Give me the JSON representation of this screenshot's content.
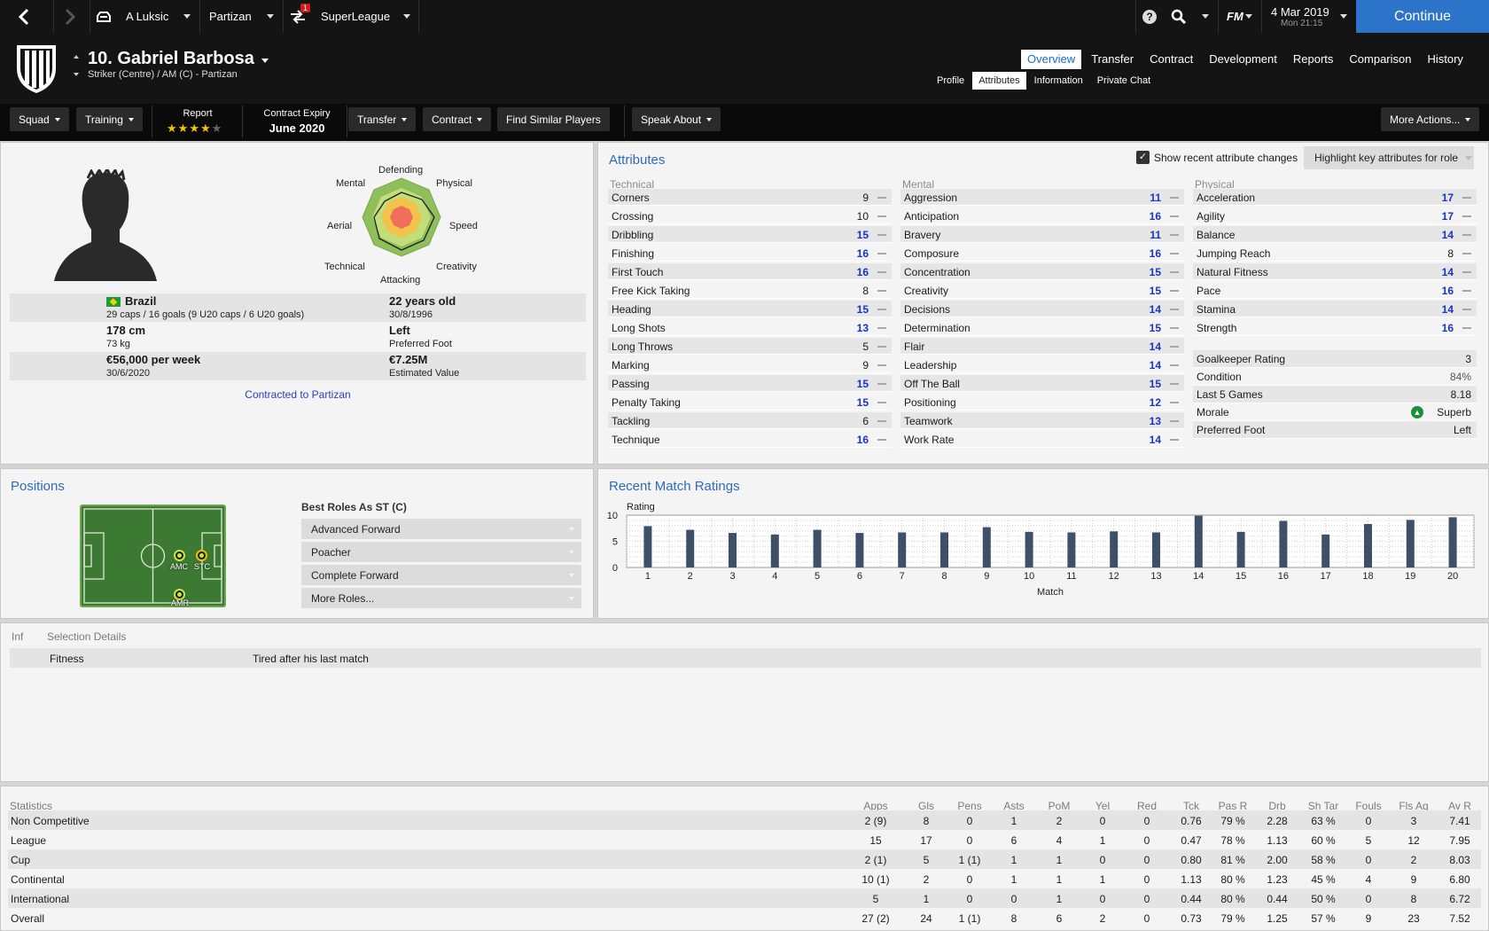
{
  "topbar": {
    "manager": "A Luksic",
    "club": "Partizan",
    "league": "SuperLeague",
    "notification_count": "1",
    "fm_logo": "FM",
    "date": "4 Mar 2019",
    "time": "Mon 21:15",
    "continue_label": "Continue",
    "icons": [
      "back-arrow",
      "forward-arrow",
      "home-icon",
      "transfer-notification-icon",
      "help-icon",
      "search-icon"
    ]
  },
  "player": {
    "name": "10. Gabriel Barbosa",
    "subtitle": "Striker (Centre) / AM (C) - Partizan"
  },
  "tabs": {
    "main": [
      "Overview",
      "Transfer",
      "Contract",
      "Development",
      "Reports",
      "Comparison",
      "History"
    ],
    "main_active": "Overview",
    "sub": [
      "Profile",
      "Attributes",
      "Information",
      "Private Chat"
    ],
    "sub_active": "Attributes"
  },
  "actionbar": {
    "squad": "Squad",
    "training": "Training",
    "report_label": "Report",
    "report_stars": 4,
    "report_stars_max": 5,
    "contract_label": "Contract Expiry",
    "contract_value": "June 2020",
    "transfer": "Transfer",
    "contract": "Contract",
    "find_similar": "Find Similar Players",
    "speak_about": "Speak About",
    "more_actions": "More Actions..."
  },
  "profile": {
    "radar_labels": {
      "defending": "Defending",
      "physical": "Physical",
      "speed": "Speed",
      "creativity": "Creativity",
      "attacking": "Attacking",
      "technical": "Technical",
      "aerial": "Aerial",
      "mental": "Mental"
    },
    "nation": "Brazil",
    "caps": "29 caps / 16 goals (9 U20 caps / 6 U20 goals)",
    "age": "22 years old",
    "dob": "30/8/1996",
    "height": "178 cm",
    "weight": "73 kg",
    "foot": "Left",
    "foot_label": "Preferred Foot",
    "wage": "€56,000 per week",
    "wage_expiry": "30/6/2020",
    "value": "€7.25M",
    "value_label": "Estimated Value",
    "contracted": "Contracted to Partizan"
  },
  "attributes": {
    "title": "Attributes",
    "show_changes": "Show recent attribute changes",
    "highlight": "Highlight key attributes for role",
    "technical_title": "Technical",
    "mental_title": "Mental",
    "physical_title": "Physical",
    "technical": [
      {
        "name": "Corners",
        "value": "9"
      },
      {
        "name": "Crossing",
        "value": "10"
      },
      {
        "name": "Dribbling",
        "value": "15"
      },
      {
        "name": "Finishing",
        "value": "16"
      },
      {
        "name": "First Touch",
        "value": "16"
      },
      {
        "name": "Free Kick Taking",
        "value": "8"
      },
      {
        "name": "Heading",
        "value": "15"
      },
      {
        "name": "Long Shots",
        "value": "13"
      },
      {
        "name": "Long Throws",
        "value": "5"
      },
      {
        "name": "Marking",
        "value": "9"
      },
      {
        "name": "Passing",
        "value": "15"
      },
      {
        "name": "Penalty Taking",
        "value": "15"
      },
      {
        "name": "Tackling",
        "value": "6"
      },
      {
        "name": "Technique",
        "value": "16"
      }
    ],
    "mental": [
      {
        "name": "Aggression",
        "value": "11"
      },
      {
        "name": "Anticipation",
        "value": "16"
      },
      {
        "name": "Bravery",
        "value": "11"
      },
      {
        "name": "Composure",
        "value": "16"
      },
      {
        "name": "Concentration",
        "value": "15"
      },
      {
        "name": "Creativity",
        "value": "15"
      },
      {
        "name": "Decisions",
        "value": "14"
      },
      {
        "name": "Determination",
        "value": "15"
      },
      {
        "name": "Flair",
        "value": "14"
      },
      {
        "name": "Leadership",
        "value": "14"
      },
      {
        "name": "Off The Ball",
        "value": "15"
      },
      {
        "name": "Positioning",
        "value": "12"
      },
      {
        "name": "Teamwork",
        "value": "13"
      },
      {
        "name": "Work Rate",
        "value": "14"
      }
    ],
    "physical": [
      {
        "name": "Acceleration",
        "value": "17"
      },
      {
        "name": "Agility",
        "value": "17"
      },
      {
        "name": "Balance",
        "value": "14"
      },
      {
        "name": "Jumping Reach",
        "value": "8"
      },
      {
        "name": "Natural Fitness",
        "value": "14"
      },
      {
        "name": "Pace",
        "value": "16"
      },
      {
        "name": "Stamina",
        "value": "14"
      },
      {
        "name": "Strength",
        "value": "16"
      }
    ],
    "misc": [
      {
        "name": "Goalkeeper Rating",
        "value": "3"
      },
      {
        "name": "Condition",
        "value": "84%"
      },
      {
        "name": "Last 5 Games",
        "value": "8.18"
      },
      {
        "name": "Morale",
        "value": "Superb"
      },
      {
        "name": "Preferred Foot",
        "value": "Left"
      }
    ]
  },
  "positions": {
    "title": "Positions",
    "best_roles_title": "Best Roles As ST (C)",
    "roles": [
      "Advanced Forward",
      "Poacher",
      "Complete Forward",
      "More Roles..."
    ],
    "pitch_labels": [
      "AMC",
      "STC",
      "AMR"
    ]
  },
  "ratings": {
    "title": "Recent Match Ratings"
  },
  "chart_data": {
    "type": "bar",
    "title": "Recent Match Ratings",
    "xlabel": "Match",
    "ylabel": "Rating",
    "categories": [
      "1",
      "2",
      "3",
      "4",
      "5",
      "6",
      "7",
      "8",
      "9",
      "10",
      "11",
      "12",
      "13",
      "14",
      "15",
      "16",
      "17",
      "18",
      "19",
      "20"
    ],
    "values": [
      7.9,
      7.2,
      6.6,
      6.3,
      7.2,
      6.6,
      6.7,
      6.7,
      7.7,
      6.8,
      6.7,
      6.9,
      6.7,
      9.9,
      6.8,
      8.9,
      6.3,
      8.3,
      9.1,
      9.6
    ],
    "yticks": [
      "0",
      "5",
      "10"
    ],
    "ylim": [
      0,
      10
    ],
    "grid": true,
    "color": "#3d5068"
  },
  "selection": {
    "col_inf": "Inf",
    "col_details": "Selection Details",
    "rows": [
      {
        "label": "Fitness",
        "detail": "Tired after his last match"
      }
    ]
  },
  "statistics": {
    "title": "Statistics",
    "columns": [
      "Apps",
      "Gls",
      "Pens",
      "Asts",
      "PoM",
      "Yel",
      "Red",
      "Tck",
      "Pas R",
      "Drb",
      "Sh Tar",
      "Fouls",
      "Fls Ag",
      "Av R"
    ],
    "rows": [
      {
        "label": "Non Competitive",
        "values": [
          "2 (9)",
          "8",
          "0",
          "1",
          "2",
          "0",
          "0",
          "0.76",
          "79 %",
          "2.28",
          "63 %",
          "0",
          "3",
          "7.41"
        ]
      },
      {
        "label": "League",
        "values": [
          "15",
          "17",
          "0",
          "6",
          "4",
          "1",
          "0",
          "0.47",
          "78 %",
          "1.13",
          "60 %",
          "5",
          "12",
          "7.95"
        ]
      },
      {
        "label": "Cup",
        "values": [
          "2 (1)",
          "5",
          "1 (1)",
          "1",
          "1",
          "0",
          "0",
          "0.80",
          "81 %",
          "2.00",
          "58 %",
          "0",
          "2",
          "8.03"
        ]
      },
      {
        "label": "Continental",
        "values": [
          "10 (1)",
          "2",
          "0",
          "1",
          "1",
          "1",
          "0",
          "1.13",
          "80 %",
          "1.23",
          "45 %",
          "4",
          "9",
          "6.80"
        ]
      },
      {
        "label": "International",
        "values": [
          "5",
          "1",
          "0",
          "0",
          "1",
          "0",
          "0",
          "0.44",
          "80 %",
          "0.44",
          "50 %",
          "0",
          "8",
          "6.72"
        ]
      },
      {
        "label": "Overall",
        "values": [
          "27 (2)",
          "24",
          "1 (1)",
          "8",
          "6",
          "2",
          "0",
          "0.73",
          "79 %",
          "1.25",
          "57 %",
          "9",
          "23",
          "7.52"
        ]
      }
    ]
  }
}
